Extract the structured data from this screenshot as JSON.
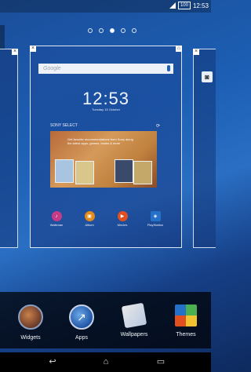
{
  "status_bar": {
    "time": "12:53",
    "battery": "100"
  },
  "pager": {
    "count": 5,
    "active_index": 2
  },
  "main_panel": {
    "search_placeholder": "Google",
    "clock": "12:53",
    "date": "Tuesday 15 October",
    "widget": {
      "title": "SONY SELECT",
      "promo_text": "Get favorite recommendations from Sony along the latest apps, games, books & more"
    },
    "apps": [
      {
        "label": "Walkman",
        "color": "#c53b86",
        "icon": "walkman-icon"
      },
      {
        "label": "Album",
        "color": "#e38a1b",
        "icon": "album-icon"
      },
      {
        "label": "Movies",
        "color": "#e35020",
        "icon": "movies-icon"
      },
      {
        "label": "PlayStation",
        "color": "#2671c8",
        "icon": "playstation-icon"
      }
    ]
  },
  "dock": {
    "items": [
      {
        "label": "Widgets",
        "icon": "widgets-icon"
      },
      {
        "label": "Apps",
        "icon": "apps-icon"
      },
      {
        "label": "Wallpapers",
        "icon": "wallpapers-icon"
      },
      {
        "label": "Themes",
        "icon": "themes-icon"
      }
    ]
  },
  "navbar": {
    "back": "back-icon",
    "home": "home-icon",
    "recents": "recents-icon"
  }
}
